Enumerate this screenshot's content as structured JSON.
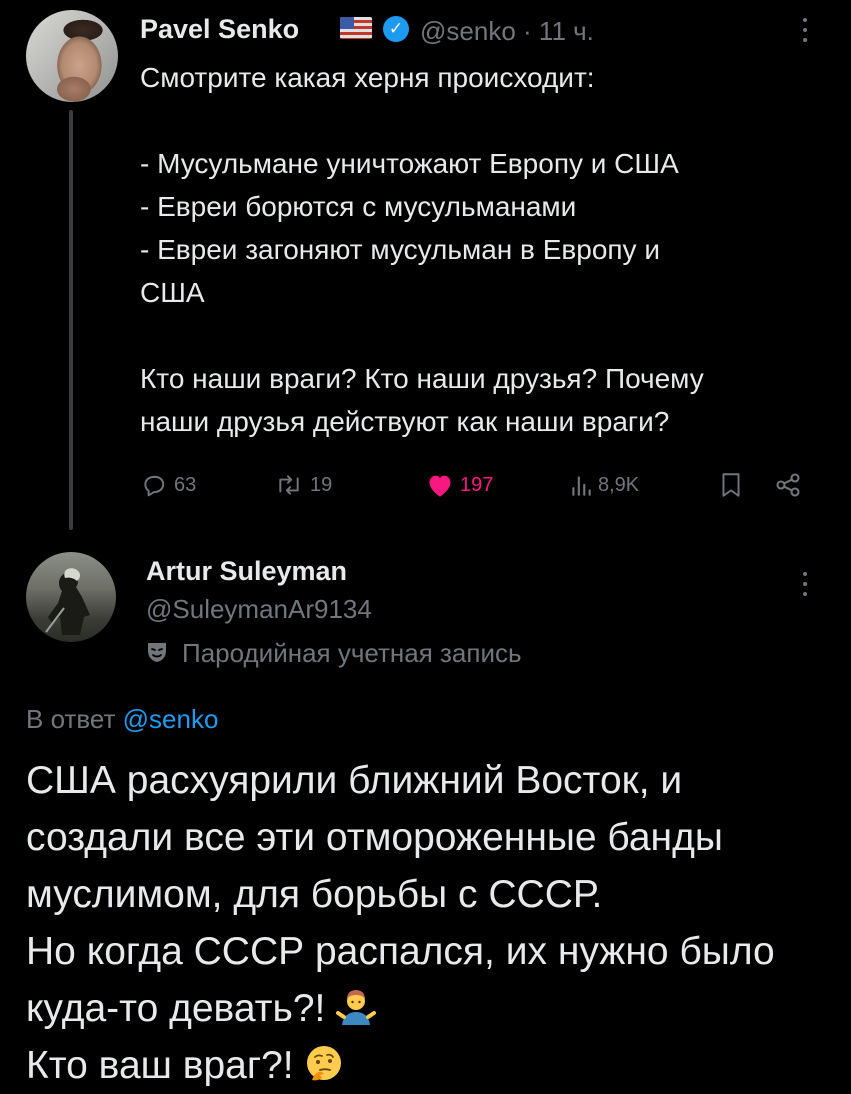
{
  "tweet": {
    "author_name": "Pavel Senko",
    "flag_icon": "us-flag-icon",
    "verified_icon": "verified-badge-icon",
    "handle": "@senko",
    "separator": "·",
    "time": "11 ч.",
    "lines": [
      "Смотрите какая херня происходит:",
      "",
      "- Мусульмане уничтожают Европу и США",
      "- Евреи борются с мусульманами",
      "- Евреи загоняют мусульман в Европу и",
      "США",
      "",
      "Кто наши враги? Кто наши друзья? Почему",
      "наши друзья действуют как наши враги?"
    ],
    "stats": {
      "replies": "63",
      "reposts": "19",
      "likes": "197",
      "views": "8,9K"
    },
    "like_color": "#f91880"
  },
  "reply": {
    "author_name": "Artur Suleyman",
    "handle": "@SuleymanAr9134",
    "parody_label": "Пародийная учетная запись",
    "reply_prefix": "В ответ",
    "reply_handle": "@senko",
    "lines": [
      "США расхуярили ближний Восток, и",
      "создали все эти отмороженные банды",
      "муслимом, для борьбы с СССР.",
      "Но когда СССР распался, их нужно было",
      "куда-то девать?!",
      "Кто ваш враг?!"
    ],
    "emoji_1": "person-shrugging-emoji",
    "emoji_2": "thinking-face-emoji"
  },
  "colors": {
    "background": "#000000",
    "text": "#e7e9ea",
    "secondary": "#71767b",
    "link": "#1d9bf0"
  }
}
